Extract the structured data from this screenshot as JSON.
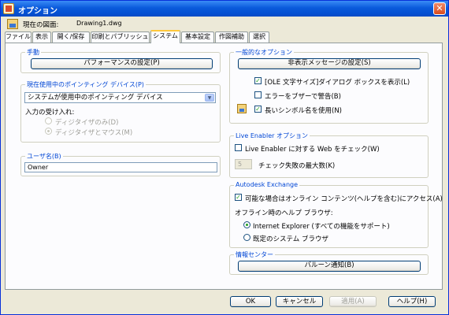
{
  "window": {
    "title": "オプション",
    "close_label": "✕"
  },
  "current_drawing": {
    "label": "現在の図面:",
    "value": "Drawing1.dwg"
  },
  "tabs": [
    "ファイル",
    "表示",
    "開く/保存",
    "印刷とパブリッシュ",
    "システム",
    "基本設定",
    "作図補助",
    "選択"
  ],
  "active_tab": "システム",
  "performance": {
    "group": "手動",
    "button": "パフォーマンスの設定(P)"
  },
  "pointing": {
    "group": "現在使用中のポインティング デバイス(P)",
    "selected": "システムが使用中のポインティング デバイス",
    "accept_label": "入力の受け入れ:",
    "options": [
      "ディジタイザのみ(D)",
      "ディジタイザとマウス(M)"
    ]
  },
  "user": {
    "group": "ユーザ名(B)",
    "value": "Owner"
  },
  "general": {
    "group": "一般的なオプション",
    "button": "非表示メッセージの設定(S)",
    "checks": [
      "[OLE 文字サイズ]ダイアログ ボックスを表示(L)",
      "エラーをブザーで警告(B)",
      "長いシンボル名を使用(N)"
    ],
    "checked": [
      true,
      false,
      true
    ]
  },
  "live": {
    "group": "Live Enabler オプション",
    "check_web": "Live Enabler に対する Web をチェック(W)",
    "max_value": "5",
    "max_label": "チェック失敗の最大数(K)"
  },
  "exchange": {
    "group": "Autodesk Exchange",
    "online": "可能な場合はオンライン コンテンツ(ヘルプを含む)にアクセス(A)",
    "offline_label": "オフライン時のヘルプ ブラウザ:",
    "browser_options": [
      "Internet Explorer (すべての機能をサポート)",
      "既定のシステム ブラウザ"
    ]
  },
  "info": {
    "group": "情報センター",
    "button": "バルーン通知(B)"
  },
  "footer": {
    "ok": "OK",
    "cancel": "キャンセル",
    "apply": "適用(A)",
    "help": "ヘルプ(H)"
  },
  "colors": {
    "title_bar": "#0a5adb",
    "group_label": "#0046d5",
    "dialog_bg": "#ece9d8",
    "close": "#d84b1d"
  },
  "icons": [
    "options-app-icon",
    "drawing-file-icon",
    "symbol-name-icon",
    "close-icon"
  ]
}
